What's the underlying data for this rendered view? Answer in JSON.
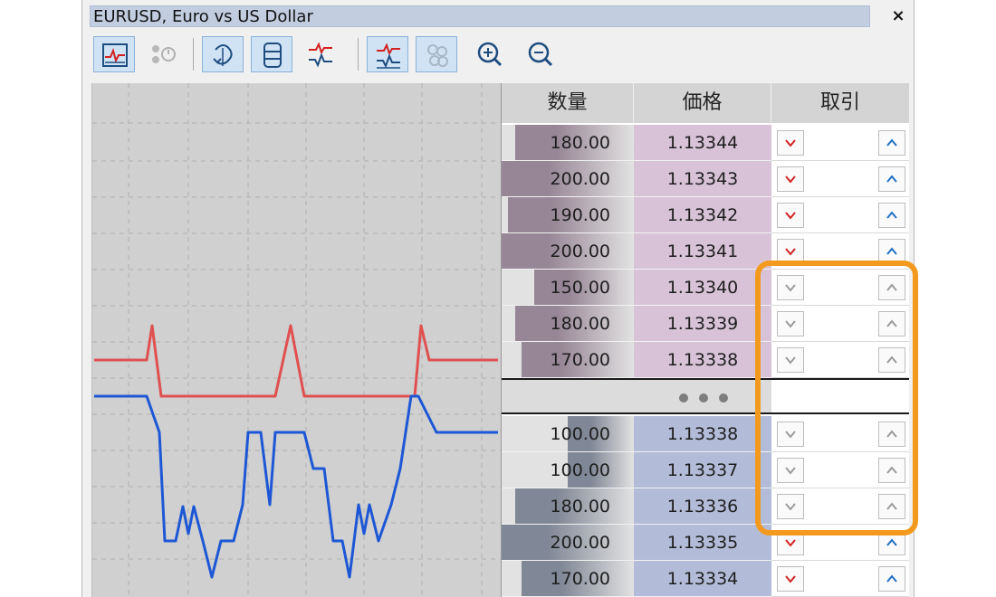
{
  "window": {
    "title": "EURUSD, Euro vs US Dollar",
    "close_label": "×"
  },
  "toolbar": {
    "buttons": [
      {
        "icon": "tick-chart-icon",
        "pressed": true
      },
      {
        "icon": "depth-of-market-icon",
        "pressed": false,
        "disabled": true
      },
      {
        "icon": "one-click-trading-icon",
        "pressed": true
      },
      {
        "icon": "market-depth-columns-icon",
        "pressed": true
      },
      {
        "icon": "tick-line-icon",
        "pressed": false
      },
      {
        "icon": "bid-ask-line-icon",
        "pressed": true
      },
      {
        "icon": "volume-circles-icon",
        "pressed": true,
        "disabled": true
      },
      {
        "icon": "zoom-in-icon",
        "pressed": false
      },
      {
        "icon": "zoom-out-icon",
        "pressed": false
      }
    ]
  },
  "book": {
    "headers": {
      "volume": "数量",
      "price": "価格",
      "trade": "取引"
    },
    "asks": [
      {
        "volume": "180.00",
        "price": "1.13344"
      },
      {
        "volume": "200.00",
        "price": "1.13343"
      },
      {
        "volume": "190.00",
        "price": "1.13342"
      },
      {
        "volume": "200.00",
        "price": "1.13341"
      },
      {
        "volume": "150.00",
        "price": "1.13340"
      },
      {
        "volume": "180.00",
        "price": "1.13339"
      },
      {
        "volume": "170.00",
        "price": "1.13338"
      }
    ],
    "bids": [
      {
        "volume": "100.00",
        "price": "1.13338"
      },
      {
        "volume": "100.00",
        "price": "1.13337"
      },
      {
        "volume": "180.00",
        "price": "1.13336"
      },
      {
        "volume": "200.00",
        "price": "1.13335"
      },
      {
        "volume": "170.00",
        "price": "1.13334"
      }
    ],
    "spread_indicator": "• • •"
  },
  "colors": {
    "ask_price_bg": "#d8c2d8",
    "ask_volume_bar": "#8a7688",
    "bid_price_bg": "#b2bcd8",
    "bid_volume_bar": "#6f7788",
    "ask_line": "#e05050",
    "bid_line": "#1d57d6",
    "sell_arrow_active": "#d42020",
    "buy_arrow_active": "#1f6fc4",
    "arrow_inactive": "#9a9a9a",
    "highlight": "#f39a1e"
  },
  "highlighted_rows": {
    "ask": [
      4,
      5,
      6
    ],
    "bid": [
      0,
      1,
      2
    ]
  }
}
